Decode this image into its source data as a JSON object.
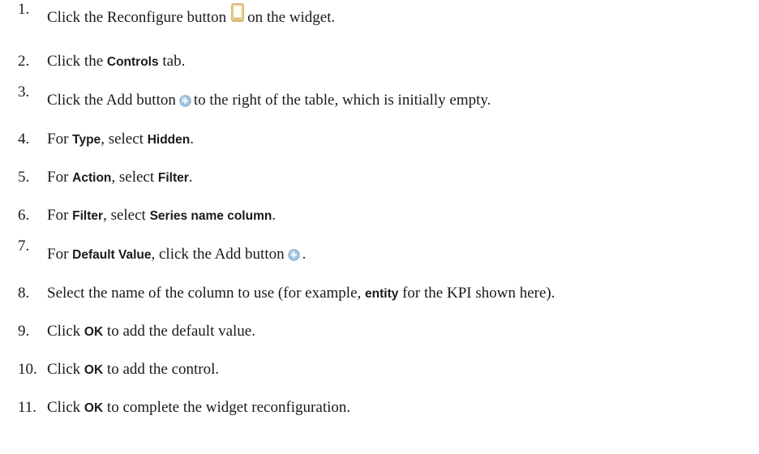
{
  "steps": [
    {
      "num": "1.",
      "parts": [
        {
          "t": "Click the Reconfigure button"
        },
        {
          "icon": "reconfigure-icon"
        },
        {
          "t": "on the widget."
        }
      ]
    },
    {
      "num": "2.",
      "parts": [
        {
          "t": "Click the "
        },
        {
          "b": "Controls"
        },
        {
          "t": " tab."
        }
      ]
    },
    {
      "num": "3.",
      "parts": [
        {
          "t": "Click the Add button"
        },
        {
          "icon": "add-icon"
        },
        {
          "t": "to the right of the table, which is initially empty."
        }
      ]
    },
    {
      "num": "4.",
      "parts": [
        {
          "t": "For "
        },
        {
          "b": "Type"
        },
        {
          "t": ", select "
        },
        {
          "b": "Hidden"
        },
        {
          "t": "."
        }
      ]
    },
    {
      "num": "5.",
      "parts": [
        {
          "t": "For "
        },
        {
          "b": "Action"
        },
        {
          "t": ", select "
        },
        {
          "b": "Filter"
        },
        {
          "t": "."
        }
      ]
    },
    {
      "num": "6.",
      "parts": [
        {
          "t": "For "
        },
        {
          "b": "Filter"
        },
        {
          "t": ", select "
        },
        {
          "b": "Series name column"
        },
        {
          "t": "."
        }
      ]
    },
    {
      "num": "7.",
      "parts": [
        {
          "t": "For "
        },
        {
          "b": "Default Value"
        },
        {
          "t": ", click the Add button"
        },
        {
          "icon": "add-icon"
        },
        {
          "t": "."
        }
      ]
    },
    {
      "num": "8.",
      "parts": [
        {
          "t": "Select the name of the column to use (for example, "
        },
        {
          "b": "entity"
        },
        {
          "t": " for the KPI shown here)."
        }
      ]
    },
    {
      "num": "9.",
      "parts": [
        {
          "t": "Click "
        },
        {
          "b": "OK"
        },
        {
          "t": " to add the default value."
        }
      ]
    },
    {
      "num": "10.",
      "parts": [
        {
          "t": "Click "
        },
        {
          "b": "OK"
        },
        {
          "t": " to add the control."
        }
      ]
    },
    {
      "num": "11.",
      "parts": [
        {
          "t": "Click "
        },
        {
          "b": "OK"
        },
        {
          "t": " to complete the widget reconfiguration."
        }
      ]
    }
  ],
  "colors": {
    "text": "#1a1a1a",
    "reconfigure_icon_border": "#c9a24a",
    "reconfigure_icon_fill": "#fff6d6",
    "add_icon_fill": "#9fc3e0",
    "add_icon_plus": "#ffffff"
  }
}
